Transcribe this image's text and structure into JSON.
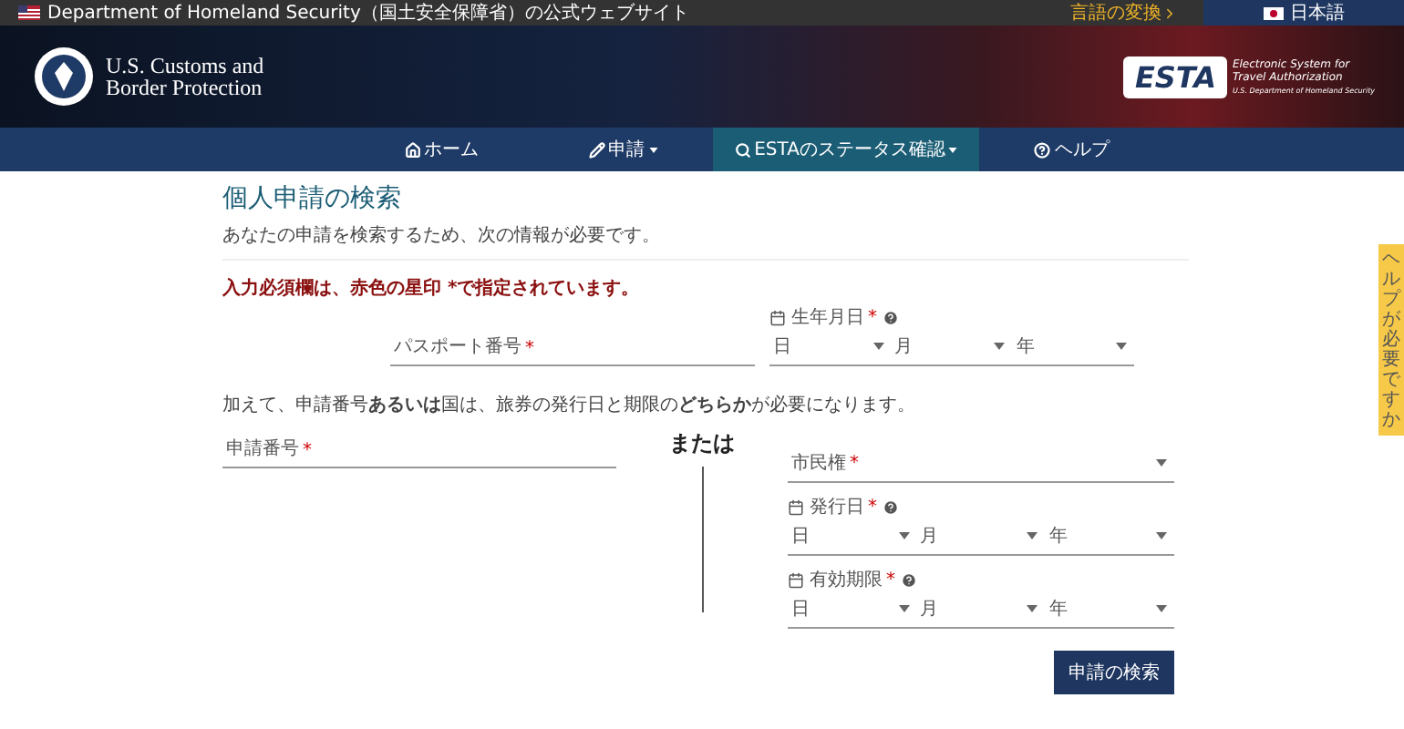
{
  "top_bar": {
    "agency": "Department of Homeland Security（国土安全保障省）の公式ウェブサイト",
    "language_change": "言語の変換",
    "language": "日本語"
  },
  "header": {
    "agency_lines": [
      "U.S. Customs and",
      "Border Protection"
    ],
    "logo_word": "ESTA",
    "logo_lines": [
      "Electronic System for",
      "Travel Authorization"
    ],
    "logo_footer": "U.S. Department of Homeland Security"
  },
  "nav": [
    {
      "label": "ホーム",
      "kind": "home",
      "dropdown": false,
      "selected": false
    },
    {
      "label": "申請",
      "kind": "apply",
      "dropdown": true,
      "selected": false
    },
    {
      "label": "ESTAのステータス確認",
      "kind": "status",
      "dropdown": true,
      "selected": true
    },
    {
      "label": "ヘルプ",
      "kind": "help",
      "dropdown": false,
      "selected": false
    }
  ],
  "form": {
    "title": "個人申請の検索",
    "subtitle": "あなたの申請を検索するため、次の情報が必要です。",
    "required_notice": "入力必須欄は、赤色の星印 *で指定されています。",
    "passport": {
      "label": "パスポート番号",
      "mark": "*"
    },
    "birth_date": {
      "label": "生年月日",
      "mark": "*",
      "selects": [
        "日",
        "月",
        "年"
      ]
    },
    "notice": "加えて、申請番号**あるいは**国は、旅券の発行日と期限の**どちらか**が必要になります。",
    "application_number": {
      "label": "申請番号",
      "mark": "*"
    },
    "separator": "または",
    "citizenship": {
      "label": "市民権",
      "mark": "*"
    },
    "issue_date": {
      "label": "発行日",
      "mark": "*",
      "selects": [
        "日",
        "月",
        "年"
      ]
    },
    "expiry_date": {
      "label": "有効期限",
      "mark": "*",
      "selects": [
        "日",
        "月",
        "年"
      ]
    },
    "submit": "申請の検索"
  },
  "side_tab": "ヘルプが必要ですか"
}
